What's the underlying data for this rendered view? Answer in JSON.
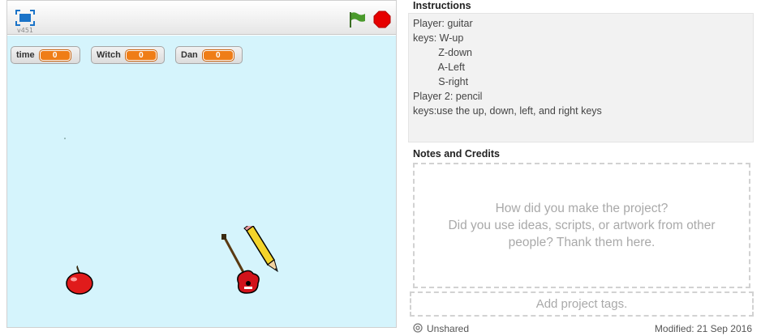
{
  "stage": {
    "version": "v451",
    "monitors": [
      {
        "label": "time",
        "value": "0"
      },
      {
        "label": "Witch",
        "value": "0"
      },
      {
        "label": "Dan",
        "value": "0"
      }
    ]
  },
  "instructions": {
    "title": "Instructions",
    "lines": [
      "Player: guitar",
      "keys: W-up",
      "         Z-down",
      "         A-Left",
      "         S-right",
      "Player 2: pencil",
      "keys:use the up, down, left, and right keys"
    ]
  },
  "notes": {
    "title": "Notes and Credits",
    "placeholder_line1": "How did you make the project?",
    "placeholder_line2": "Did you use ideas, scripts, or artwork from other",
    "placeholder_line3": "people? Thank them here."
  },
  "tags": {
    "placeholder": "Add project tags."
  },
  "footer": {
    "status": "Unshared",
    "modified": "Modified: 21 Sep 2016"
  },
  "colors": {
    "stage_bg": "#d5f4fc",
    "monitor_value": "#ef7d17",
    "flag": "#4a9a2c",
    "stop": "#e60000"
  }
}
